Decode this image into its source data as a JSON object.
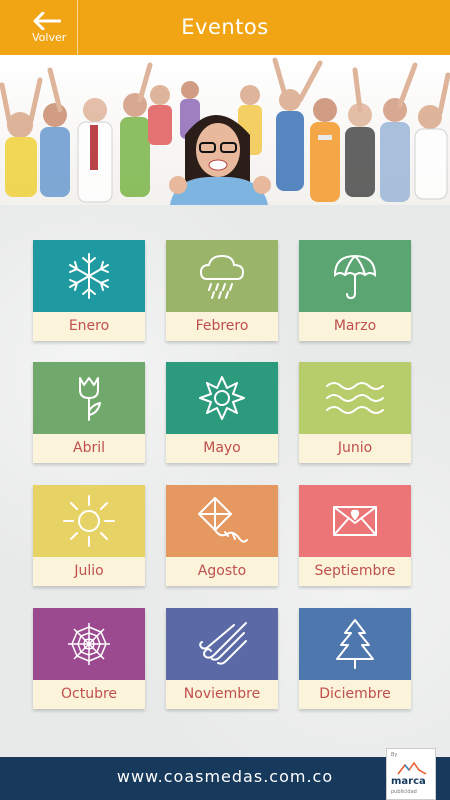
{
  "header": {
    "back_label": "Volver",
    "title": "Eventos"
  },
  "colors": {
    "header": "#f2a514",
    "footer": "#16395c",
    "tile_label_bg": "#fbf3da",
    "tile_label_text": "#c0504d"
  },
  "banner": {
    "description_icon": "crowd-photo"
  },
  "months": [
    {
      "label": "Enero",
      "icon": "snowflake-icon",
      "color": "#1f9aa0"
    },
    {
      "label": "Febrero",
      "icon": "rain-cloud-icon",
      "color": "#9ab56a"
    },
    {
      "label": "Marzo",
      "icon": "umbrella-icon",
      "color": "#5aa571"
    },
    {
      "label": "Abril",
      "icon": "tulip-icon",
      "color": "#71a86c"
    },
    {
      "label": "Mayo",
      "icon": "flower-icon",
      "color": "#2c9a7d"
    },
    {
      "label": "Junio",
      "icon": "waves-icon",
      "color": "#b7cd6c"
    },
    {
      "label": "Julio",
      "icon": "sun-icon",
      "color": "#e7d266"
    },
    {
      "label": "Agosto",
      "icon": "kite-icon",
      "color": "#e5985f"
    },
    {
      "label": "Septiembre",
      "icon": "envelope-heart-icon",
      "color": "#ec7577"
    },
    {
      "label": "Octubre",
      "icon": "spiderweb-icon",
      "color": "#9c4a8f"
    },
    {
      "label": "Noviembre",
      "icon": "wind-icon",
      "color": "#5b6aa6"
    },
    {
      "label": "Diciembre",
      "icon": "pine-tree-icon",
      "color": "#4d77ad"
    }
  ],
  "footer": {
    "url": "www.coasmedas.com.co"
  },
  "brand": {
    "by": "By",
    "name": "marca",
    "sub": "publicidad"
  }
}
